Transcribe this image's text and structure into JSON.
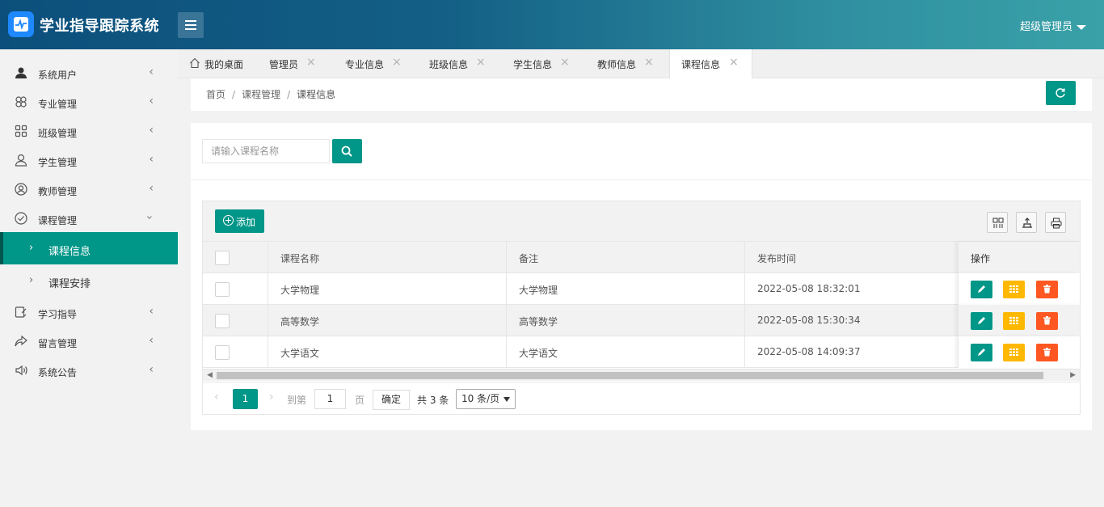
{
  "app": {
    "title": "学业指导跟踪系统",
    "user": "超级管理员"
  },
  "sidebar": {
    "items": [
      {
        "label": "系统用户",
        "icon": "user-icon"
      },
      {
        "label": "专业管理",
        "icon": "flower-icon"
      },
      {
        "label": "班级管理",
        "icon": "grid-icon"
      },
      {
        "label": "学生管理",
        "icon": "student-icon"
      },
      {
        "label": "教师管理",
        "icon": "teacher-icon"
      },
      {
        "label": "课程管理",
        "icon": "check-circle-icon",
        "expanded": true
      },
      {
        "label": "学习指导",
        "icon": "guide-icon"
      },
      {
        "label": "留言管理",
        "icon": "share-icon"
      },
      {
        "label": "系统公告",
        "icon": "speaker-icon"
      }
    ],
    "sub": [
      {
        "label": "课程信息",
        "active": true
      },
      {
        "label": "课程安排",
        "active": false
      }
    ]
  },
  "tabs": [
    {
      "label": "我的桌面",
      "icon": "home-icon",
      "closable": false
    },
    {
      "label": "管理员",
      "closable": true
    },
    {
      "label": "专业信息",
      "closable": true
    },
    {
      "label": "班级信息",
      "closable": true
    },
    {
      "label": "学生信息",
      "closable": true
    },
    {
      "label": "教师信息",
      "closable": true
    },
    {
      "label": "课程信息",
      "closable": true,
      "active": true
    }
  ],
  "breadcrumb": [
    "首页",
    "课程管理",
    "课程信息"
  ],
  "search": {
    "placeholder": "请输入课程名称"
  },
  "toolbar": {
    "add_label": "添加"
  },
  "table": {
    "columns": [
      "课程名称",
      "备注",
      "发布时间",
      "操作"
    ],
    "rows": [
      {
        "name": "大学物理",
        "note": "大学物理",
        "time": "2022-05-08 18:32:01"
      },
      {
        "name": "高等数学",
        "note": "高等数学",
        "time": "2022-05-08 15:30:34"
      },
      {
        "name": "大学语文",
        "note": "大学语文",
        "time": "2022-05-08 14:09:37"
      }
    ]
  },
  "pager": {
    "current": "1",
    "goto_label": "到第",
    "goto_value": "1",
    "page_label": "页",
    "confirm_label": "确定",
    "total_label": "共 3 条",
    "page_size": "10 条/页"
  },
  "colors": {
    "primary": "#009688",
    "warning": "#ffb800",
    "danger": "#ff5722",
    "header_start": "#0c4f7c",
    "header_end": "#3aa1a8"
  }
}
